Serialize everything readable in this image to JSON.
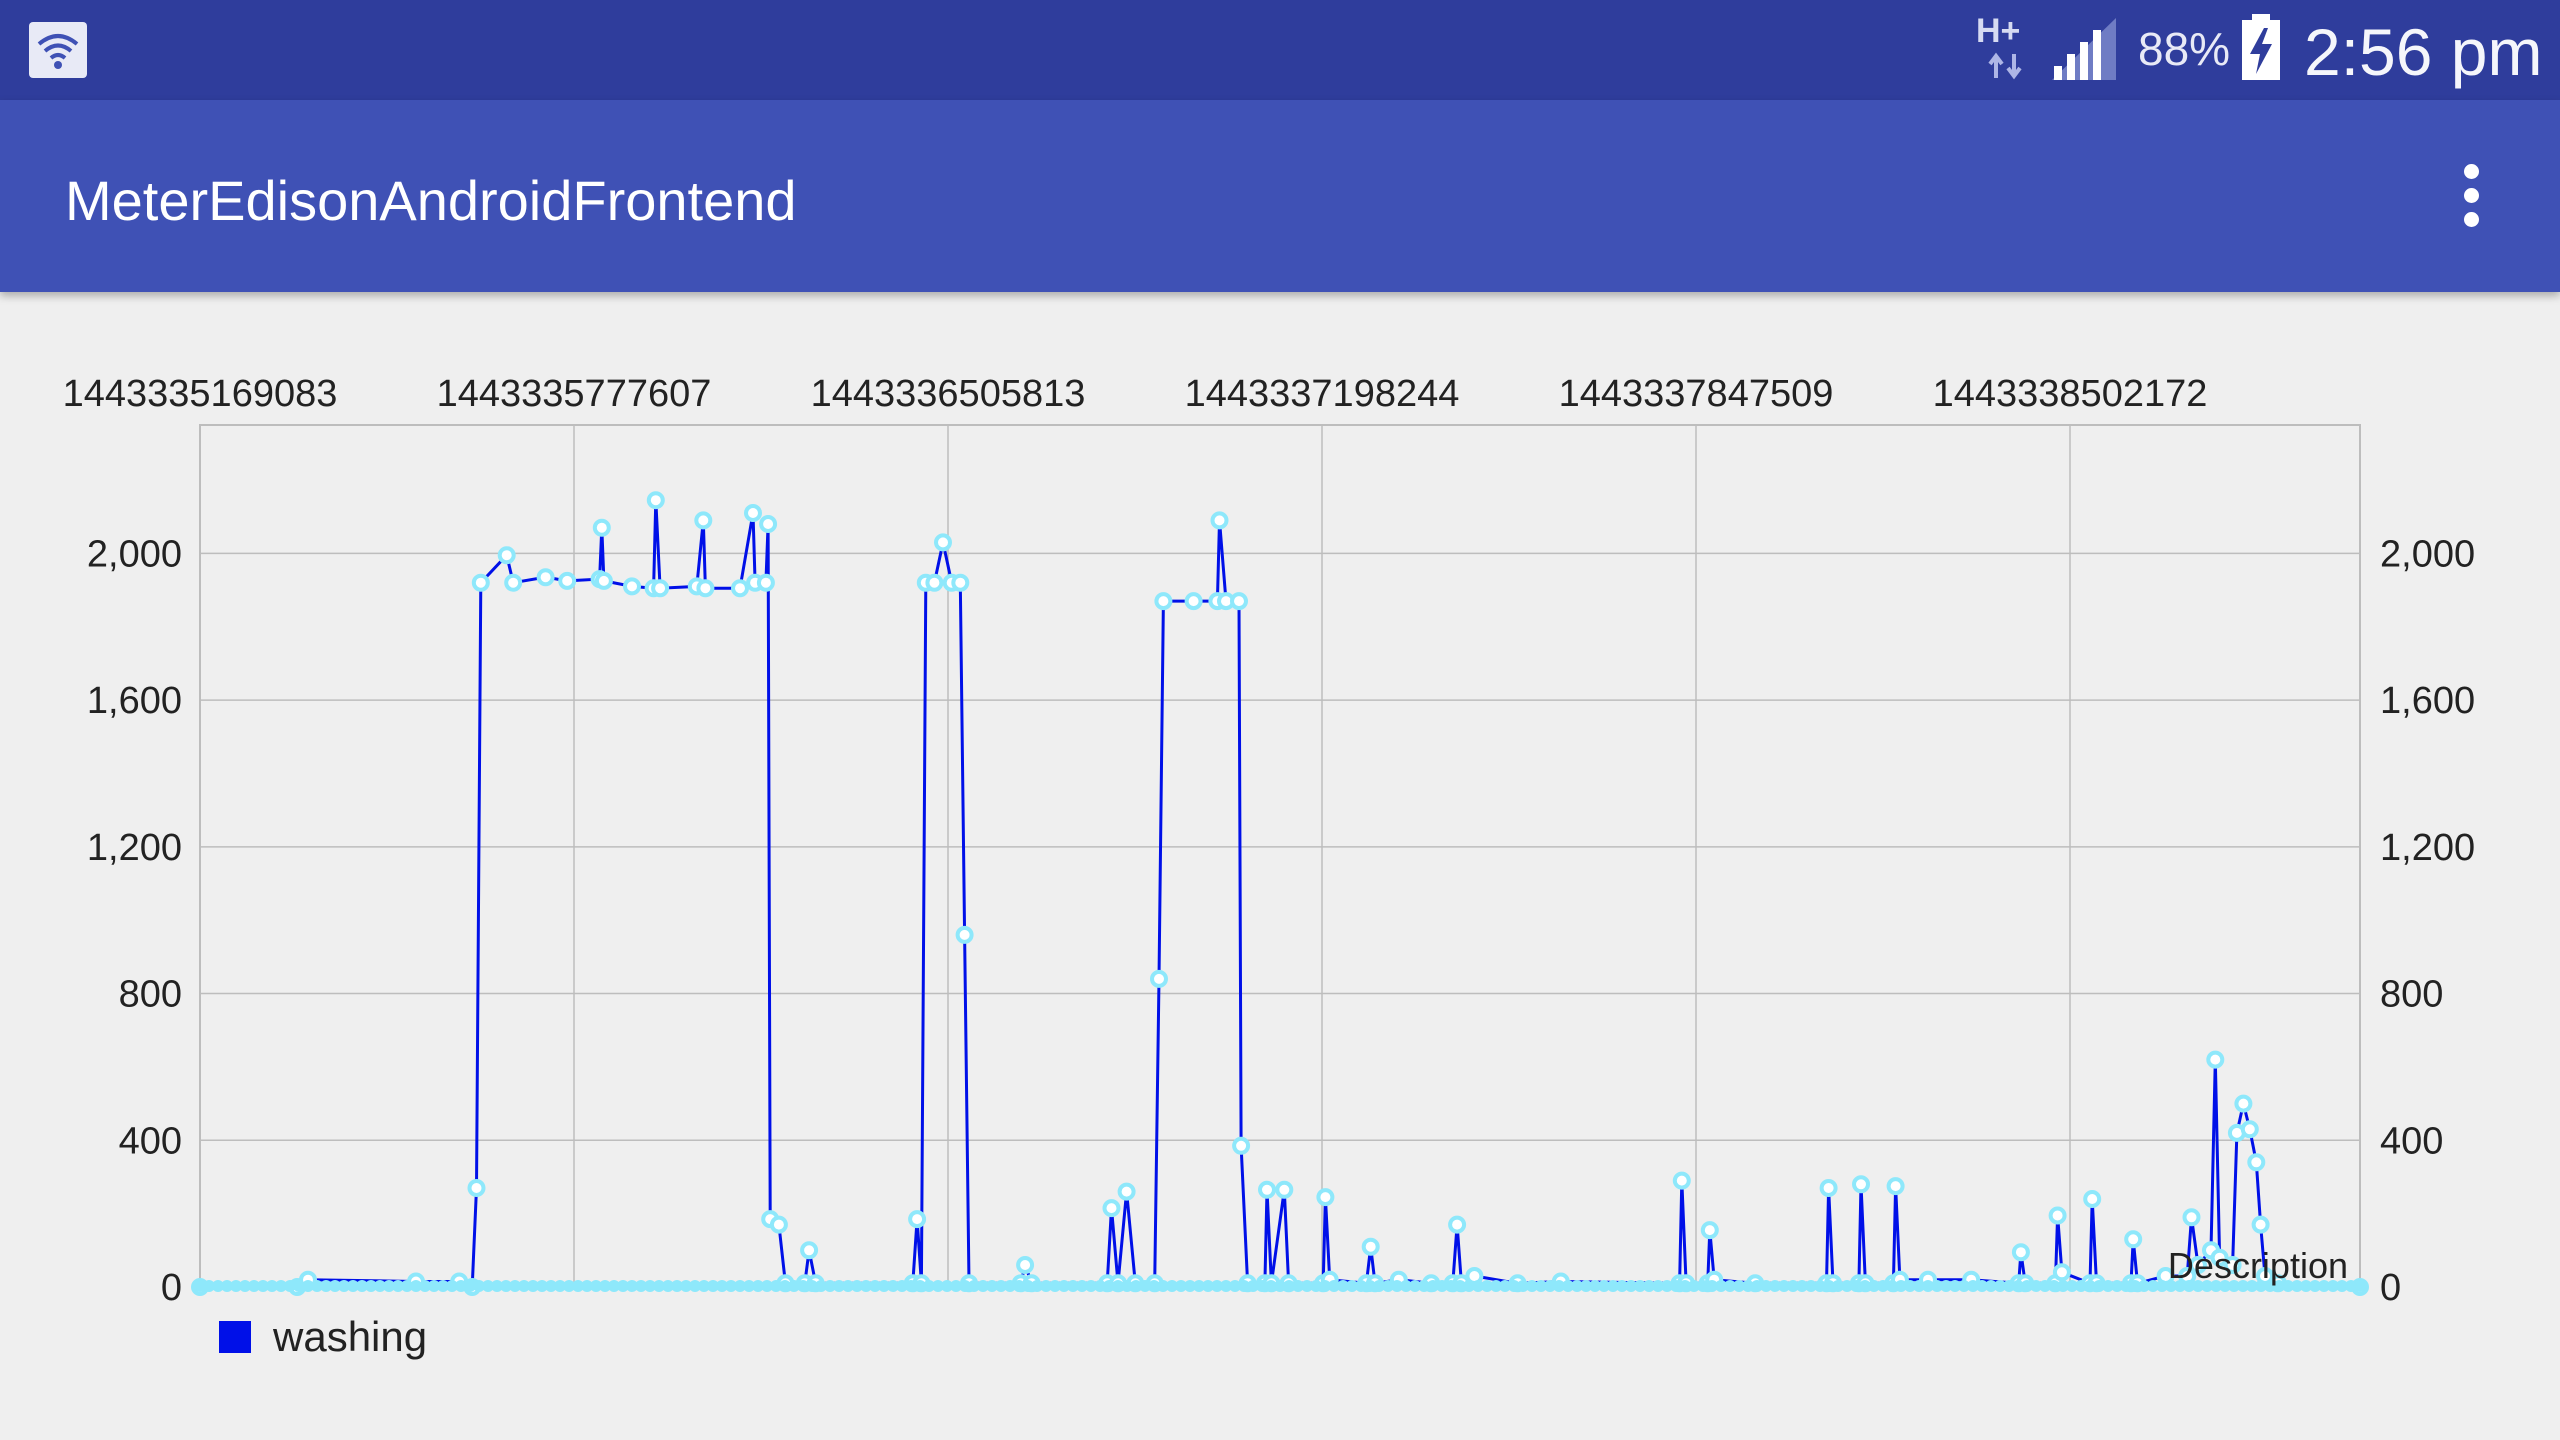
{
  "status_bar": {
    "network_type": "H+",
    "battery": "88%",
    "time": "2:56 pm",
    "icons": [
      "wifi-icon",
      "data-arrows-icon",
      "signal-icon",
      "battery-charging-icon"
    ]
  },
  "app_bar": {
    "title": "MeterEdisonAndroidFrontend",
    "menu_icon": "overflow-menu-icon"
  },
  "chart_data": {
    "type": "line",
    "description_label": "Description",
    "x_tick_labels": [
      "1443335169083",
      "1443335777607",
      "1443336505813",
      "1443337198244",
      "1443337847509",
      "1443338502172"
    ],
    "y_ticks": [
      0,
      400,
      800,
      1200,
      1600,
      2000
    ],
    "y_tick_labels": [
      "0",
      "400",
      "800",
      "1,200",
      "1,600",
      "2,000"
    ],
    "y_tick_labels_right": [
      "0",
      "400",
      "800",
      "1,200",
      "1,600",
      "2,000"
    ],
    "ylim": [
      0,
      2350
    ],
    "grid": true,
    "legend_position": "bottom-left",
    "colors": {
      "line": "#0010e8",
      "markers": "#8ee8fb",
      "baseline": "#f6c08f",
      "grid": "#bdbdbd"
    },
    "series": [
      {
        "name": "washing",
        "points": [
          [
            0,
            0
          ],
          [
            4.5,
            0
          ],
          [
            5,
            20
          ],
          [
            10,
            15
          ],
          [
            12,
            15
          ],
          [
            12.6,
            0
          ],
          [
            12.8,
            270
          ],
          [
            13,
            1920
          ],
          [
            14.2,
            1995
          ],
          [
            14.5,
            1920
          ],
          [
            16,
            1935
          ],
          [
            17,
            1925
          ],
          [
            18.5,
            1930
          ],
          [
            18.6,
            2070
          ],
          [
            18.7,
            1925
          ],
          [
            20,
            1910
          ],
          [
            21,
            1905
          ],
          [
            21.1,
            2145
          ],
          [
            21.3,
            1905
          ],
          [
            23,
            1910
          ],
          [
            23.3,
            2090
          ],
          [
            23.4,
            1905
          ],
          [
            25,
            1905
          ],
          [
            25.6,
            2110
          ],
          [
            25.7,
            1920
          ],
          [
            26.2,
            1920
          ],
          [
            26.3,
            2080
          ],
          [
            26.4,
            185
          ],
          [
            26.8,
            170
          ],
          [
            27.1,
            10
          ],
          [
            28,
            10
          ],
          [
            28.2,
            100
          ],
          [
            28.5,
            10
          ],
          [
            33,
            10
          ],
          [
            33.2,
            185
          ],
          [
            33.4,
            10
          ],
          [
            33.6,
            1920
          ],
          [
            34,
            1920
          ],
          [
            34.4,
            2030
          ],
          [
            34.8,
            1920
          ],
          [
            35.2,
            1920
          ],
          [
            35.4,
            960
          ],
          [
            35.6,
            10
          ],
          [
            38,
            10
          ],
          [
            38.2,
            60
          ],
          [
            38.5,
            10
          ],
          [
            42,
            10
          ],
          [
            42.2,
            215
          ],
          [
            42.5,
            10
          ],
          [
            42.9,
            260
          ],
          [
            43.3,
            10
          ],
          [
            44.2,
            10
          ],
          [
            44.4,
            840
          ],
          [
            44.6,
            1870
          ],
          [
            46,
            1870
          ],
          [
            47.1,
            1870
          ],
          [
            47.2,
            2090
          ],
          [
            47.5,
            1870
          ],
          [
            48.1,
            1870
          ],
          [
            48.2,
            385
          ],
          [
            48.5,
            10
          ],
          [
            49.3,
            10
          ],
          [
            49.4,
            265
          ],
          [
            49.6,
            10
          ],
          [
            50.2,
            265
          ],
          [
            50.4,
            10
          ],
          [
            52,
            10
          ],
          [
            52.1,
            245
          ],
          [
            52.3,
            20
          ],
          [
            54,
            10
          ],
          [
            54.2,
            110
          ],
          [
            54.4,
            10
          ],
          [
            55.5,
            20
          ],
          [
            57,
            10
          ],
          [
            58,
            10
          ],
          [
            58.2,
            170
          ],
          [
            58.4,
            10
          ],
          [
            59,
            30
          ],
          [
            61,
            10
          ],
          [
            63,
            15
          ],
          [
            68.5,
            10
          ],
          [
            68.6,
            290
          ],
          [
            68.8,
            10
          ],
          [
            69.8,
            10
          ],
          [
            69.9,
            155
          ],
          [
            70.1,
            20
          ],
          [
            72,
            10
          ],
          [
            75.3,
            10
          ],
          [
            75.4,
            270
          ],
          [
            75.6,
            10
          ],
          [
            76.8,
            10
          ],
          [
            76.9,
            280
          ],
          [
            77.1,
            10
          ],
          [
            78.4,
            10
          ],
          [
            78.5,
            275
          ],
          [
            78.7,
            20
          ],
          [
            80,
            20
          ],
          [
            82,
            20
          ],
          [
            84.2,
            10
          ],
          [
            84.3,
            95
          ],
          [
            84.5,
            10
          ],
          [
            85.9,
            10
          ],
          [
            86,
            195
          ],
          [
            86.2,
            40
          ],
          [
            87.5,
            10
          ],
          [
            87.6,
            240
          ],
          [
            87.8,
            10
          ],
          [
            89.4,
            10
          ],
          [
            89.5,
            130
          ],
          [
            89.7,
            10
          ],
          [
            91,
            30
          ],
          [
            92,
            30
          ],
          [
            92.2,
            190
          ],
          [
            92.5,
            60
          ],
          [
            93.1,
            100
          ],
          [
            93.3,
            620
          ],
          [
            93.5,
            80
          ],
          [
            94.1,
            60
          ],
          [
            94.3,
            420
          ],
          [
            94.6,
            500
          ],
          [
            94.9,
            430
          ],
          [
            95.2,
            340
          ],
          [
            95.4,
            170
          ],
          [
            95.6,
            30
          ],
          [
            96.2,
            10
          ],
          [
            100,
            0
          ]
        ]
      }
    ]
  }
}
